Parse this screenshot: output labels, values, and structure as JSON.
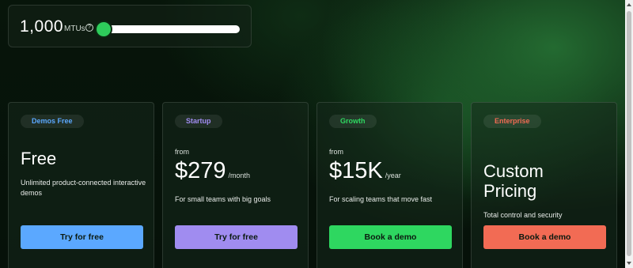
{
  "mtu_slider": {
    "value_text": "1,000",
    "unit": "MTUs",
    "help_icon": "help-circle-icon",
    "level": 0.0
  },
  "colors": {
    "accent_green": "#2ecc5b",
    "blue": "#5ba8ff",
    "purple": "#a08cf0",
    "green": "#2ed760",
    "orange": "#f26b54"
  },
  "plans": [
    {
      "badge": "Demos Free",
      "from": "",
      "price": "Free",
      "period": "",
      "description": "Unlimited product-connected interactive demos",
      "button": "Try for free"
    },
    {
      "badge": "Startup",
      "from": "from",
      "price": "$279",
      "period": "/month",
      "description": "For small teams with big goals",
      "button": "Try for free"
    },
    {
      "badge": "Growth",
      "from": "from",
      "price": "$15K",
      "period": "/year",
      "description": "For scaling teams that move fast",
      "button": "Book a demo"
    },
    {
      "badge": "Enterprise",
      "from": "",
      "price": "Custom Pricing",
      "period": "",
      "description": "Total control and security",
      "button": "Book a demo"
    }
  ]
}
